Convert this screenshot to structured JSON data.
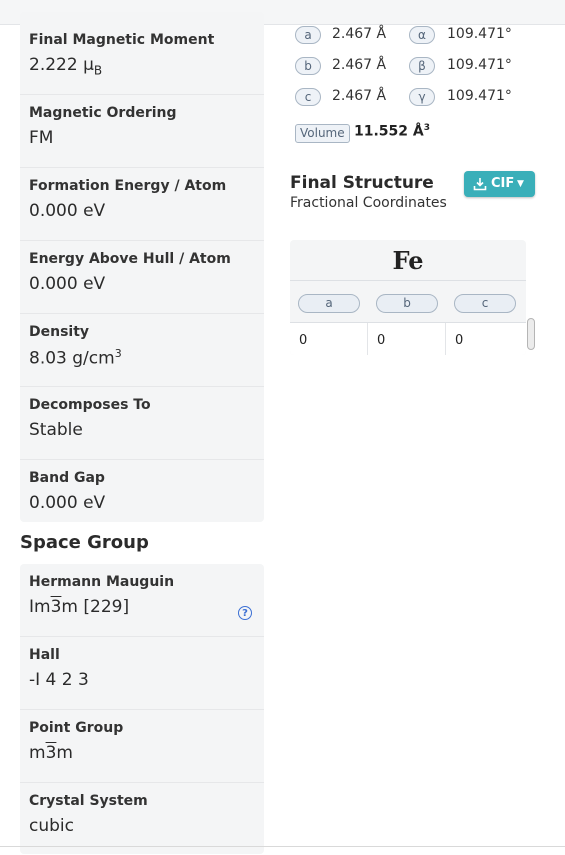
{
  "props_top": [
    {
      "label": "Final Magnetic Moment",
      "value": "2.222 μ",
      "sub": "B"
    },
    {
      "label": "Magnetic Ordering",
      "value": "FM"
    },
    {
      "label": "Formation Energy / Atom",
      "value": "0.000 eV"
    },
    {
      "label": "Energy Above Hull / Atom",
      "value": "0.000 eV"
    },
    {
      "label": "Density",
      "value": "8.03 g/cm",
      "sup": "3"
    },
    {
      "label": "Decomposes To",
      "value": "Stable"
    },
    {
      "label": "Band Gap",
      "value": "0.000 eV"
    }
  ],
  "space_group": {
    "title": "Space Group",
    "hm_label": "Hermann Mauguin",
    "hm_pre": "Im",
    "hm_bar": "3",
    "hm_post": "m [229]",
    "hall_label": "Hall",
    "hall_value": "-I 4 2 3",
    "pg_label": "Point Group",
    "pg_pre": "m",
    "pg_bar": "3",
    "pg_post": "m",
    "cs_label": "Crystal System",
    "cs_value": "cubic",
    "help_icon": "?"
  },
  "lattice": {
    "a_label": "a",
    "a_value": "2.467 Å",
    "b_label": "b",
    "b_value": "2.467 Å",
    "c_label": "c",
    "c_value": "2.467 Å",
    "alpha_label": "α",
    "alpha_value": "109.471°",
    "beta_label": "β",
    "beta_value": "109.471°",
    "gamma_label": "γ",
    "gamma_value": "109.471°",
    "volume_label": "Volume",
    "volume_value": "11.552 Å",
    "volume_sup": "3"
  },
  "final_structure": {
    "title": "Final Structure",
    "subtitle": "Fractional Coordinates",
    "cif_label": "CIF",
    "download_icon": "download-icon",
    "element": "Fe",
    "columns": [
      "a",
      "b",
      "c"
    ],
    "row": [
      "0",
      "0",
      "0"
    ]
  }
}
